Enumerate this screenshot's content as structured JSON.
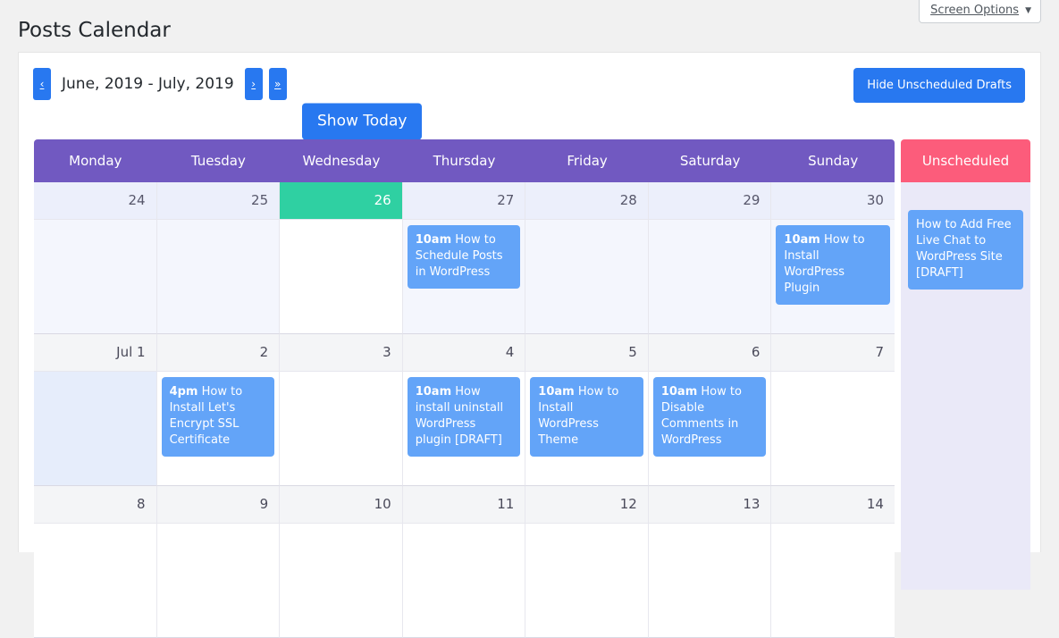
{
  "screen_options": {
    "label": "Screen Options",
    "caret": "▼",
    "caret_icon_name": "chevron-down-icon"
  },
  "page": {
    "title": "Posts Calendar"
  },
  "toolbar": {
    "prev_label": "‹",
    "period_label": "June, 2019 - July, 2019",
    "next_label": "›",
    "next_jump_label": "»",
    "show_today_label": "Show Today",
    "hide_drafts_label": "Hide Unscheduled Drafts"
  },
  "calendar": {
    "day_headers": [
      "Monday",
      "Tuesday",
      "Wednesday",
      "Thursday",
      "Friday",
      "Saturday",
      "Sunday"
    ],
    "unscheduled_header": "Unscheduled",
    "colors": {
      "header_purple": "#7159c1",
      "unscheduled_red": "#fc5c7b",
      "today_green": "#2fd0a2",
      "post_blue": "#63a4f8",
      "button_blue": "#2878f0",
      "unscheduled_bg": "#eae9f8",
      "past_day_bg": "#eceffb"
    },
    "weeks": [
      {
        "days": [
          {
            "num": "24",
            "state": "past",
            "posts": []
          },
          {
            "num": "25",
            "state": "past",
            "posts": []
          },
          {
            "num": "26",
            "state": "today",
            "posts": []
          },
          {
            "num": "27",
            "state": "past",
            "posts": [
              {
                "time": "10am",
                "title": "How to Schedule Posts in WordPress"
              }
            ]
          },
          {
            "num": "28",
            "state": "past",
            "posts": []
          },
          {
            "num": "29",
            "state": "past",
            "posts": []
          },
          {
            "num": "30",
            "state": "past",
            "posts": [
              {
                "time": "10am",
                "title": "How to Install WordPress Plugin"
              }
            ]
          }
        ]
      },
      {
        "days": [
          {
            "num": "Jul 1",
            "state": "highlight",
            "posts": []
          },
          {
            "num": "2",
            "state": "normal",
            "posts": [
              {
                "time": "4pm",
                "title": "How to Install Let's Encrypt SSL Certificate"
              }
            ]
          },
          {
            "num": "3",
            "state": "normal",
            "posts": []
          },
          {
            "num": "4",
            "state": "normal",
            "posts": [
              {
                "time": "10am",
                "title": "How install uninstall WordPress plugin [DRAFT]"
              }
            ]
          },
          {
            "num": "5",
            "state": "normal",
            "posts": [
              {
                "time": "10am",
                "title": "How to Install WordPress Theme"
              }
            ]
          },
          {
            "num": "6",
            "state": "normal",
            "posts": [
              {
                "time": "10am",
                "title": "How to Disable Comments in WordPress"
              }
            ]
          },
          {
            "num": "7",
            "state": "normal",
            "posts": []
          }
        ]
      },
      {
        "days": [
          {
            "num": "8",
            "state": "normal",
            "posts": []
          },
          {
            "num": "9",
            "state": "normal",
            "posts": []
          },
          {
            "num": "10",
            "state": "normal",
            "posts": []
          },
          {
            "num": "11",
            "state": "normal",
            "posts": []
          },
          {
            "num": "12",
            "state": "normal",
            "posts": []
          },
          {
            "num": "13",
            "state": "normal",
            "posts": []
          },
          {
            "num": "14",
            "state": "normal",
            "posts": []
          }
        ]
      }
    ],
    "unscheduled_posts": [
      {
        "title": "How to Add Free Live Chat to WordPress Site [DRAFT]"
      }
    ]
  }
}
